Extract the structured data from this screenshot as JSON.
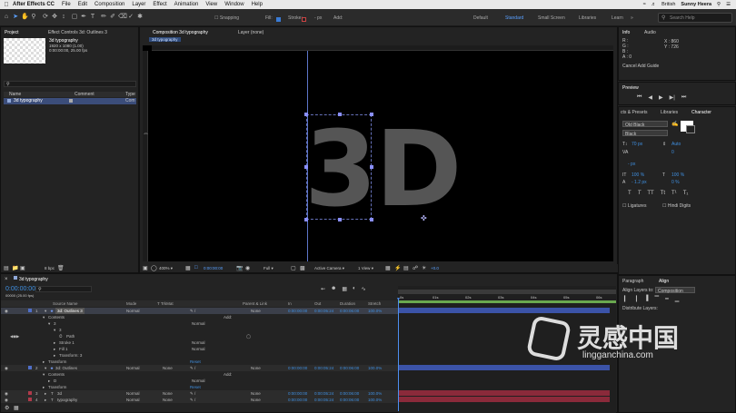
{
  "menubar": {
    "app": "After Effects CC",
    "items": [
      "File",
      "Edit",
      "Composition",
      "Layer",
      "Effect",
      "Animation",
      "View",
      "Window",
      "Help"
    ],
    "right": {
      "lang": "British",
      "user": "Sunny Heera"
    }
  },
  "toolbar": {
    "snapping": "Snapping",
    "fill": "Fill:",
    "stroke": "Stroke:",
    "stroke_px": "- px",
    "add": "Add:",
    "workspaces": [
      "Default",
      "Standard",
      "Small Screen",
      "Libraries",
      "Learn"
    ],
    "active_workspace": "Standard",
    "search_placeholder": "Search Help"
  },
  "project": {
    "tabs": [
      "Project",
      "Effect Controls 3d: Outlines 3"
    ],
    "comp_name": "3d typography",
    "comp_info": [
      "1920 x 1080 (1.00)",
      "0:00:00:00, 25.00 fps"
    ],
    "col_name": "Name",
    "col_comment": "Comment",
    "col_type": "Type",
    "item_name": "3d typography",
    "item_type": "Com",
    "bpc": "8 bpc"
  },
  "comp_panel": {
    "tab": "Composition 3d typography",
    "layer_tab": "Layer (none)",
    "crumb": "3d typography",
    "artwork_text": "3D",
    "zoom": "400%",
    "time": "0:00:00:00",
    "resolution": "Full",
    "camera": "Active Camera",
    "views": "1 View",
    "offset": "+0.0"
  },
  "timeline": {
    "tab": "3d typography",
    "timecode": "0:00:00:00",
    "fps_info": "00000 (25.00 fps)",
    "headers": [
      "Source Name",
      "Mode",
      "T TrkMat",
      "Parent & Link",
      "In",
      "Out",
      "Duration",
      "Stretch"
    ],
    "rows": [
      {
        "num": "1",
        "name": "3d: Outlines 3",
        "mode": "Normal",
        "parent": "None",
        "in": "0:00:00:00",
        "out": "0:00:05:24",
        "dur": "0:00:06:00",
        "stretch": "100.0%",
        "color": "#4f6fc8"
      },
      {
        "label": "Contents",
        "add": "Add:"
      },
      {
        "label": "3"
      },
      {
        "label": "3"
      },
      {
        "label": "Path"
      },
      {
        "label": "Stroke 1",
        "blend": "Normal"
      },
      {
        "label": "Fill 1",
        "blend": "Normal"
      },
      {
        "label": "Transform: 3"
      },
      {
        "label": "Transform",
        "reset": "Reset"
      },
      {
        "num": "2",
        "name": "3d: Outlines",
        "mode": "Normal",
        "trkmat": "None",
        "parent": "None",
        "in": "0:00:00:00",
        "out": "0:00:05:24",
        "dur": "0:00:06:00",
        "stretch": "100.0%",
        "color": "#4f6fc8"
      },
      {
        "label": "Contents",
        "add": "Add:"
      },
      {
        "label": "D",
        "blend": "Normal"
      },
      {
        "label": "Transform",
        "reset": "Reset"
      },
      {
        "num": "3",
        "name": "3d",
        "mode": "Normal",
        "trkmat": "None",
        "parent": "None",
        "in": "0:00:00:00",
        "out": "0:00:05:24",
        "dur": "0:00:06:00",
        "stretch": "100.0%",
        "color": "#b03a4a"
      },
      {
        "num": "4",
        "name": "typography",
        "mode": "Normal",
        "trkmat": "None",
        "parent": "None",
        "in": "0:00:00:00",
        "out": "0:00:05:24",
        "dur": "0:00:06:00",
        "stretch": "100.0%",
        "color": "#b03a4a"
      }
    ],
    "ruler_ticks": [
      "0s",
      "01s",
      "02s",
      "03s",
      "04s",
      "05s",
      "06s"
    ]
  },
  "info_panel": {
    "tabs": [
      "Info",
      "Audio"
    ],
    "r": "R :",
    "g": "G :",
    "b": "B :",
    "a": "A : 0",
    "x": "X : 860",
    "y": "Y : 726",
    "status": "Cancel Add Guide"
  },
  "preview": {
    "title": "Preview"
  },
  "character": {
    "tabs": [
      "cts & Presets",
      "Libraries",
      "Character"
    ],
    "font": "Old Black",
    "style": "Black",
    "size": "70 px",
    "leading": "Auto",
    "tracking": "0",
    "kerning": "- px",
    "vscale": "100 %",
    "hscale": "100 %",
    "baseline": "- 1.2 px",
    "tsume": "0 %",
    "ligatures": "Ligatures",
    "hindi": "Hindi Digits"
  },
  "align": {
    "tabs": [
      "Paragraph",
      "Align"
    ],
    "align_to_label": "Align Layers to:",
    "align_to": "Composition",
    "distribute": "Distribute Layers:"
  },
  "watermark": {
    "brand": "灵感中国",
    "url": "lingganchina.com"
  }
}
